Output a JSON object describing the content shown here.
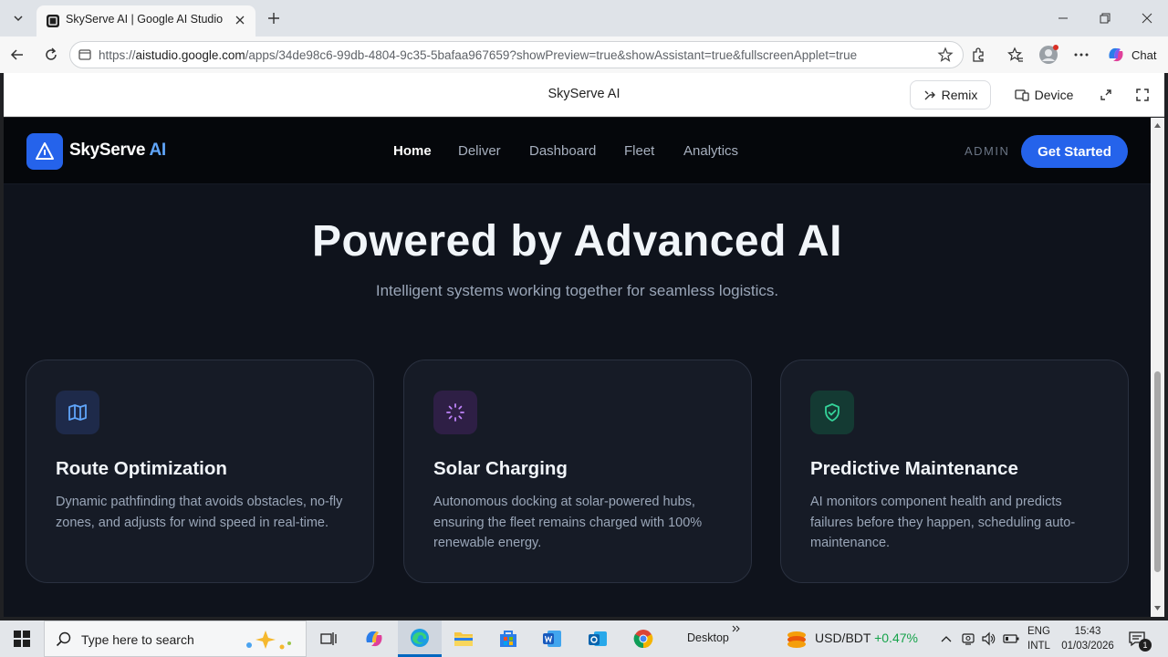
{
  "browser": {
    "tab_title": "SkyServe AI | Google AI Studio",
    "url_prefix": "https://",
    "url_host": "aistudio.google.com",
    "url_path": "/apps/34de98c6-99db-4804-9c35-5bafaa967659?showPreview=true&showAssistant=true&fullscreenApplet=true",
    "chat_label": "Chat"
  },
  "studio": {
    "title": "SkyServe AI",
    "remix_label": "Remix",
    "device_label": "Device"
  },
  "app": {
    "logo_main": "SkyServe",
    "logo_accent": "AI",
    "nav": [
      "Home",
      "Deliver",
      "Dashboard",
      "Fleet",
      "Analytics"
    ],
    "active_nav": "Home",
    "admin_label": "ADMIN",
    "cta_label": "Get Started",
    "hero_title": "Powered by Advanced AI",
    "hero_subtitle": "Intelligent systems working together for seamless logistics.",
    "features": [
      {
        "icon": "map-icon",
        "title": "Route Optimization",
        "description": "Dynamic pathfinding that avoids obstacles, no-fly zones, and adjusts for wind speed in real-time.",
        "icon_bg": "#1e2a4a",
        "icon_color": "#60a5fa"
      },
      {
        "icon": "loader-icon",
        "title": "Solar Charging",
        "description": "Autonomous docking at solar-powered hubs, ensuring the fleet remains charged with 100% renewable energy.",
        "icon_bg": "#2e1f45",
        "icon_color": "#c084fc"
      },
      {
        "icon": "shield-check-icon",
        "title": "Predictive Maintenance",
        "description": "AI monitors component health and predicts failures before they happen, scheduling auto-maintenance.",
        "icon_bg": "#143a33",
        "icon_color": "#34d399"
      }
    ],
    "accent_color": "#2563eb"
  },
  "taskbar": {
    "search_placeholder": "Type here to search",
    "desktop_label": "Desktop",
    "ticker_pair": "USD/BDT",
    "ticker_change": "+0.47%",
    "lang_line1": "ENG",
    "lang_line2": "INTL",
    "time": "15:43",
    "date": "01/03/2026",
    "notification_count": "1"
  }
}
